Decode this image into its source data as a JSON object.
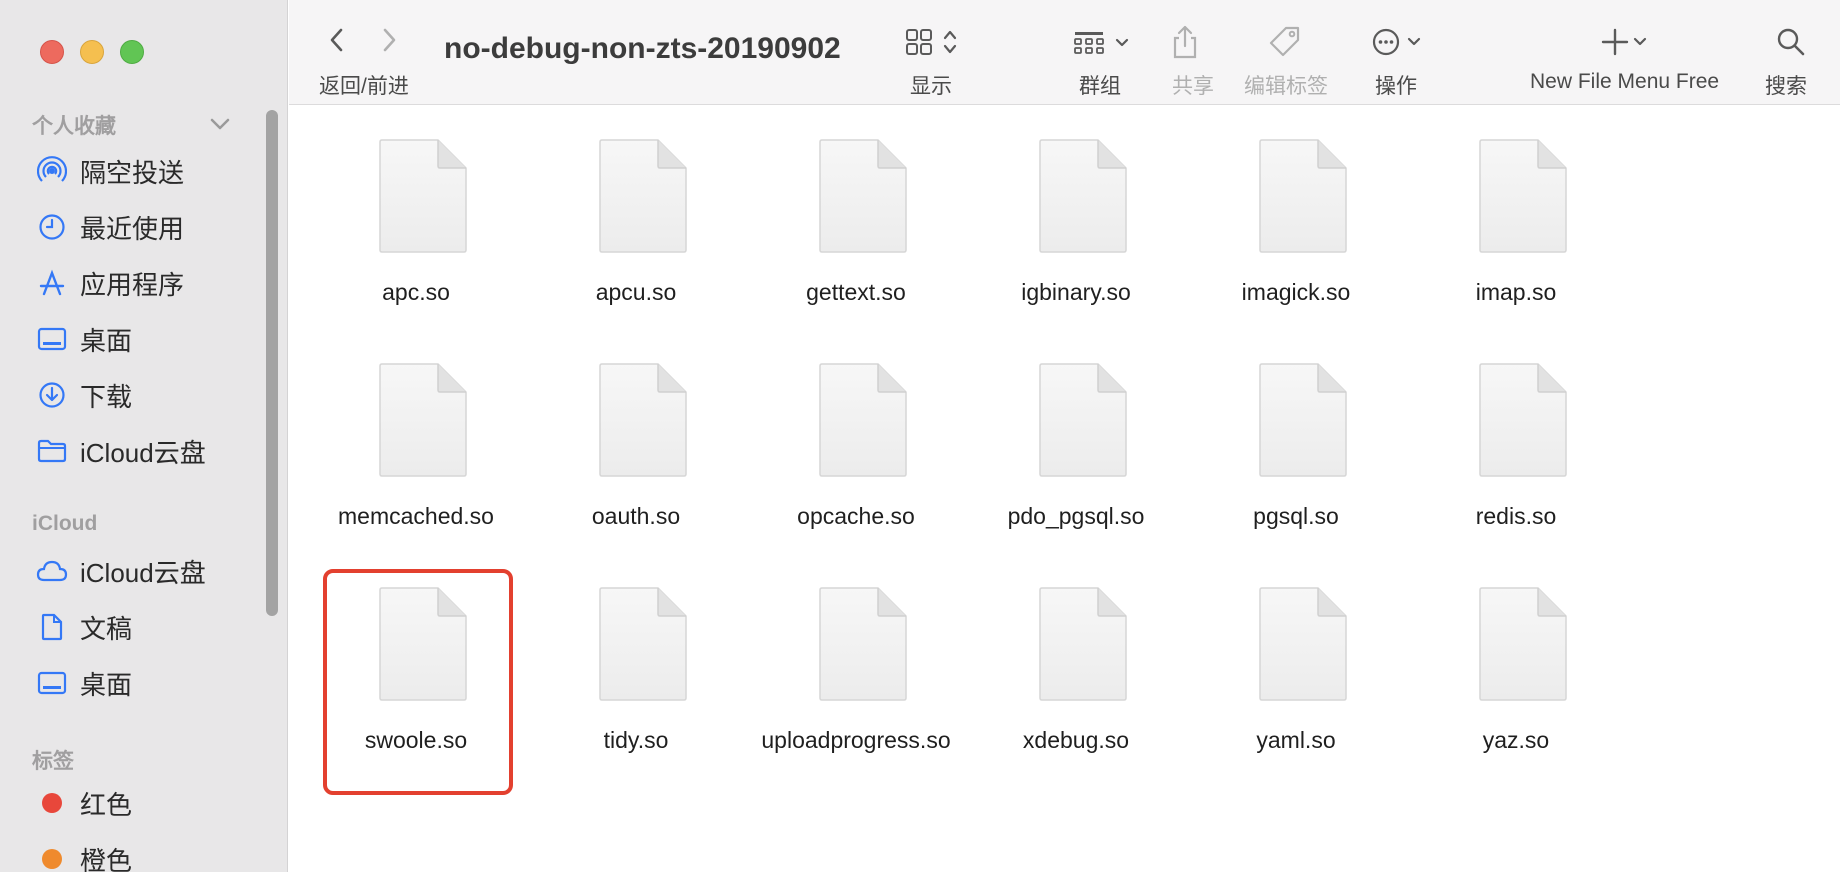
{
  "window": {
    "title": "no-debug-non-zts-20190902"
  },
  "toolbar": {
    "nav_label": "返回/前进",
    "view_label": "显示",
    "group_label": "群组",
    "share_label": "共享",
    "tags_label": "编辑标签",
    "action_label": "操作",
    "newfile_label": "New File Menu Free",
    "search_label": "搜索"
  },
  "sidebar": {
    "favorites_heading": "个人收藏",
    "favorites": [
      {
        "label": "隔空投送",
        "icon": "airdrop-icon"
      },
      {
        "label": "最近使用",
        "icon": "clock-icon"
      },
      {
        "label": "应用程序",
        "icon": "applications-icon"
      },
      {
        "label": "桌面",
        "icon": "desktop-icon"
      },
      {
        "label": "下载",
        "icon": "download-icon"
      },
      {
        "label": "iCloud云盘",
        "icon": "folder-icon"
      }
    ],
    "icloud_heading": "iCloud",
    "icloud": [
      {
        "label": "iCloud云盘",
        "icon": "cloud-icon"
      },
      {
        "label": "文稿",
        "icon": "document-icon"
      },
      {
        "label": "桌面",
        "icon": "desktop-icon"
      }
    ],
    "tags_heading": "标签",
    "tags": [
      {
        "label": "红色",
        "color": "#e8473b"
      },
      {
        "label": "橙色",
        "color": "#ef8a2d"
      }
    ]
  },
  "files": [
    {
      "name": "apc.so"
    },
    {
      "name": "apcu.so"
    },
    {
      "name": "gettext.so"
    },
    {
      "name": "igbinary.so"
    },
    {
      "name": "imagick.so"
    },
    {
      "name": "imap.so"
    },
    {
      "name": "memcached.so"
    },
    {
      "name": "oauth.so"
    },
    {
      "name": "opcache.so"
    },
    {
      "name": "pdo_pgsql.so"
    },
    {
      "name": "pgsql.so"
    },
    {
      "name": "redis.so"
    },
    {
      "name": "swoole.so",
      "highlighted": true
    },
    {
      "name": "tidy.so"
    },
    {
      "name": "uploadprogress.so"
    },
    {
      "name": "xdebug.so"
    },
    {
      "name": "yaml.so"
    },
    {
      "name": "yaz.so"
    }
  ],
  "colors": {
    "sidebar_icon": "#3478f6",
    "highlight": "#e3402f"
  }
}
